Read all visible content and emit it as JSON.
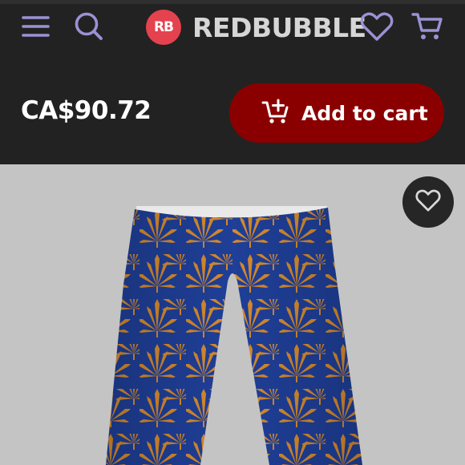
{
  "header": {
    "brand_name": "REDBUBBLE",
    "logo_mark_text": "RB",
    "icons": {
      "menu": "hamburger-menu-icon",
      "search": "search-icon",
      "wishlist": "heart-icon",
      "cart": "shopping-cart-icon"
    }
  },
  "purchase_bar": {
    "price": "CA$90.72",
    "add_to_cart_label": "Add to cart",
    "add_to_cart_icon": "add-to-cart-icon"
  },
  "product": {
    "image_subject": "leggings with leaf print",
    "favorite_icon": "heart-icon"
  },
  "colors": {
    "header_bg": "#222222",
    "icon_purple": "#9b92d4",
    "logo_red": "#e4424f",
    "cart_button": "#8a0000",
    "product_bg": "#c4c4c4",
    "leggings_blue": "#1f3f98",
    "leaf_orange": "#d58a2d"
  }
}
